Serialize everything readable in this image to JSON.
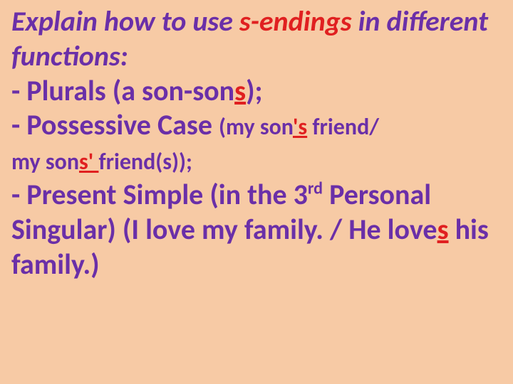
{
  "intro": {
    "part1": "Explain how to use ",
    "highlight": "s-endings",
    "part2": " in different functions:"
  },
  "plurals": {
    "lead": "- Plurals (a son-son",
    "s": "s",
    "tail": ");"
  },
  "possessive": {
    "lead": "- Possessive Case ",
    "ex1a": "(my son",
    "ex1s": "'s",
    "ex1b": " friend/ ",
    "ex2a": "my son",
    "ex2s": "s' ",
    "ex2b": "friend(s));"
  },
  "present": {
    "lead1": "- Present Simple (in the 3",
    "ord": "rd",
    "lead2": " Personal Singular) (I love my family. / He love",
    "s": "s",
    "tail": " his family.)"
  }
}
